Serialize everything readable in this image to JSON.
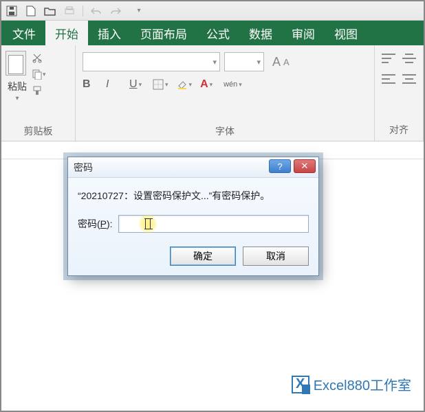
{
  "qat": {
    "save_icon": "save",
    "new_icon": "new",
    "open_icon": "open",
    "print_icon": "print",
    "undo_icon": "undo",
    "redo_icon": "redo"
  },
  "tabs": {
    "file": "文件",
    "home": "开始",
    "insert": "插入",
    "layout": "页面布局",
    "formulas": "公式",
    "data": "数据",
    "review": "审阅",
    "view": "视图"
  },
  "ribbon": {
    "clipboard": {
      "paste": "粘贴",
      "group_label": "剪贴板"
    },
    "font": {
      "bold": "B",
      "italic": "I",
      "underline": "U",
      "a_big": "A",
      "a_small": "A",
      "wen": "wén",
      "group_label": "字体"
    },
    "align": {
      "group_label": "对齐"
    }
  },
  "dialog": {
    "title": "密码",
    "message": "“20210727：设置密码保护文...”有密码保护。",
    "label_prefix": "密码(",
    "label_key": "P",
    "label_suffix": "):",
    "ok": "确定",
    "cancel": "取消",
    "help": "?",
    "close": "✕"
  },
  "watermark": {
    "text": "Excel880工作室",
    "icon": "X"
  }
}
